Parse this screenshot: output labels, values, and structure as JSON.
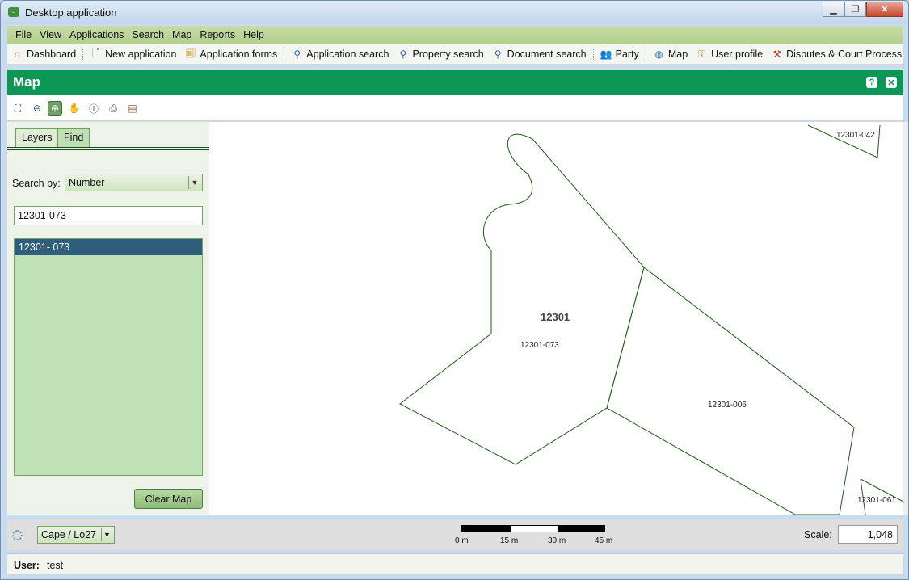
{
  "window": {
    "title": "Desktop application"
  },
  "menu": [
    "File",
    "View",
    "Applications",
    "Search",
    "Map",
    "Reports",
    "Help"
  ],
  "toolbar": {
    "dashboard": "Dashboard",
    "new_application": "New application",
    "application_forms": "Application forms",
    "application_search": "Application search",
    "property_search": "Property search",
    "document_search": "Document search",
    "party": "Party",
    "map": "Map",
    "user_profile": "User profile",
    "disputes": "Disputes & Court Process"
  },
  "panel": {
    "title": "Map"
  },
  "left": {
    "tabs": [
      "Layers",
      "Find"
    ],
    "search_by_label": "Search by:",
    "search_by_value": "Number",
    "search_input": "12301-073",
    "results": [
      "12301- 073"
    ],
    "clear_button": "Clear Map"
  },
  "map": {
    "labels": {
      "main": "12301",
      "parcel_073": "12301-073",
      "parcel_006": "12301-006",
      "parcel_042": "12301-042",
      "parcel_061": "12301-061"
    },
    "stroke_color": "#1a5e10"
  },
  "status": {
    "crs": "Cape / Lo27",
    "scale_ticks": [
      "0 m",
      "15 m",
      "30 m",
      "45 m"
    ],
    "scale_label": "Scale:",
    "scale_value": "1,048"
  },
  "user": {
    "label": "User:",
    "name": "test"
  }
}
